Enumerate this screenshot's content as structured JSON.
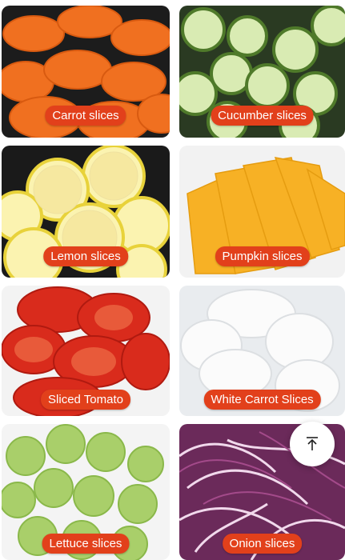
{
  "tiles": [
    {
      "label": "Carrot slices"
    },
    {
      "label": "Cucumber slices"
    },
    {
      "label": "Lemon slices"
    },
    {
      "label": "Pumpkin slices"
    },
    {
      "label": "Sliced Tomato"
    },
    {
      "label": "White Carrot Slices"
    },
    {
      "label": "Lettuce slices"
    },
    {
      "label": "Onion slices"
    }
  ],
  "label_color": "#e2401b",
  "icons": {
    "back_to_top": "arrow-up-to-line-icon"
  }
}
